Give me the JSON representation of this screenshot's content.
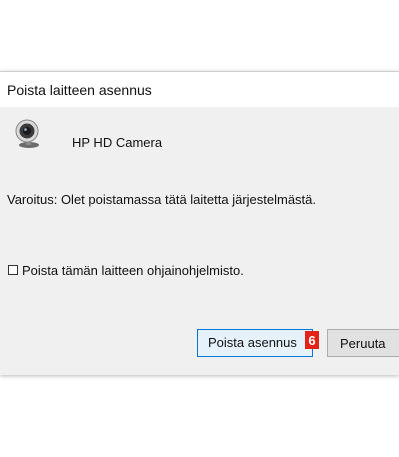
{
  "dialog": {
    "title": "Poista laitteen asennus",
    "device_name": "HP HD Camera",
    "device_icon": "webcam-icon",
    "warning_text": "Varoitus: Olet poistamassa tätä laitetta järjestelmästä.",
    "checkbox": {
      "label": "Poista tämän laitteen ohjainohjelmisto.",
      "checked": false
    },
    "buttons": {
      "confirm_label": "Poista asennus",
      "cancel_label": "Peruuta"
    },
    "step_marker": "6",
    "colors": {
      "accent": "#0078d7",
      "marker": "#e32218",
      "dialog_bg": "#f0f0f0"
    }
  }
}
